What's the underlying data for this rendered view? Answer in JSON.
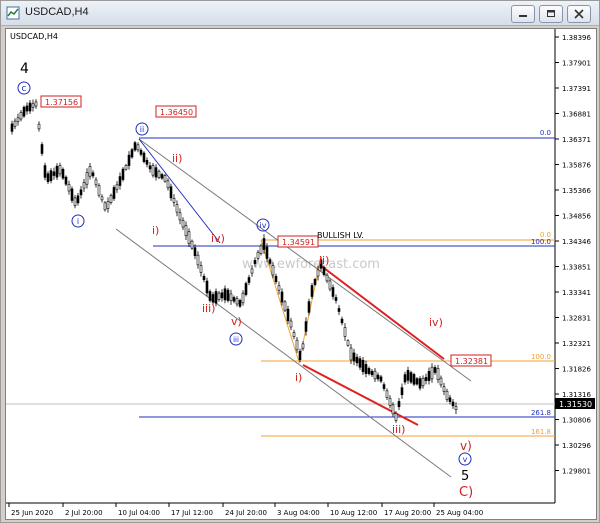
{
  "window": {
    "title": "USDCAD,H4"
  },
  "chart": {
    "symbol_label": "USDCAD,H4",
    "watermark": "www.ewforecast.com",
    "price_axis": [
      "1.38396",
      "1.37901",
      "1.37391",
      "1.36881",
      "1.36371",
      "1.35876",
      "1.35366",
      "1.34856",
      "1.34346",
      "1.33851",
      "1.33341",
      "1.32831",
      "1.32321",
      "1.31826",
      "1.31316",
      "1.30806",
      "1.30296",
      "1.29801"
    ],
    "time_axis": [
      "25 Jun 2020",
      "2 Jul 20:00",
      "10 Jul 04:00",
      "17 Jul 12:00",
      "24 Jul 20:00",
      "3 Aug 04:00",
      "10 Aug 12:00",
      "17 Aug 20:00",
      "25 Aug 04:00"
    ],
    "current_price": "1.31530",
    "price_boxes": {
      "p1": "1.37156",
      "p2": "1.36450",
      "p3": "1.34591",
      "p4": "1.32381"
    },
    "fib_labels": {
      "f0_top": "0.0",
      "f0_mid": "0.0",
      "f100_mid": "100.0",
      "f100_low": "100.0",
      "f2618": "261.8",
      "f1618": "161.8"
    },
    "note": "BULLISH LV.",
    "waves": {
      "w4": "4",
      "wC_top": "c",
      "wii_blue": "ii",
      "wi_blue": "i",
      "wiv_blue": "iv",
      "wiii_blue": "iii",
      "wv_blue": "v",
      "r_ii1": "ii)",
      "r_i1": "i)",
      "r_iv1": "iv)",
      "r_iii1": "iii)",
      "r_v1": "v)",
      "r_ii2": "ii)",
      "r_i2": "i)",
      "r_iii2": "iii)",
      "r_iv2": "iv)",
      "r_v2": "v)",
      "w5": "5",
      "wC_end": "C)"
    }
  }
}
